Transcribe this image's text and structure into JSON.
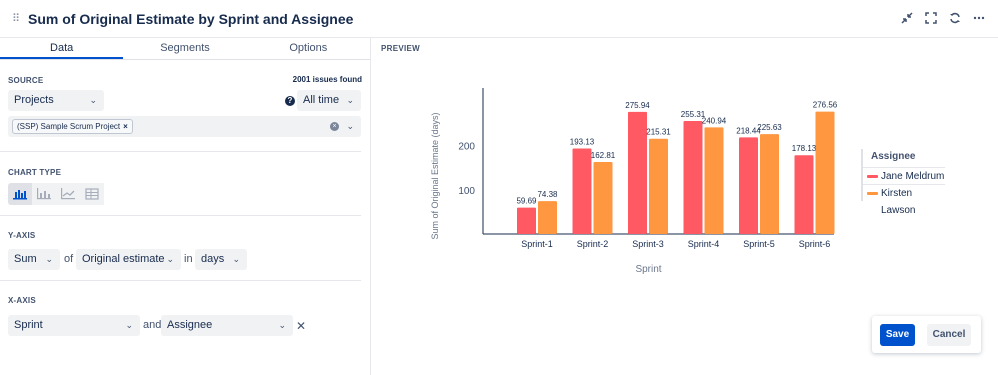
{
  "header": {
    "title": "Sum of Original Estimate by Sprint and Assignee",
    "drag_glyph": "⠿",
    "icons": [
      "minimize-icon",
      "fullscreen-icon",
      "refresh-icon",
      "more-icon"
    ]
  },
  "tabs": [
    {
      "label": "Data",
      "active": true
    },
    {
      "label": "Segments",
      "active": false
    },
    {
      "label": "Options",
      "active": false
    }
  ],
  "source": {
    "label": "SOURCE",
    "issues_found": "2001 issues found",
    "type_value": "Projects",
    "time_value": "All time",
    "project_tag": "(SSP) Sample Scrum Project"
  },
  "chart_type": {
    "label": "CHART TYPE",
    "options": [
      "bar-chart-icon",
      "stacked-bar-icon",
      "line-chart-icon",
      "table-icon"
    ],
    "selected": "bar-chart-icon"
  },
  "y_axis": {
    "label": "Y-AXIS",
    "aggregation": "Sum",
    "word_of": "of",
    "field": "Original estimate",
    "word_in": "in",
    "unit": "days"
  },
  "x_axis": {
    "label": "X-AXIS",
    "field": "Sprint",
    "word_and": "and",
    "segment": "Assignee"
  },
  "preview": {
    "label": "PREVIEW",
    "legend_title": "Assignee"
  },
  "chart_data": {
    "type": "bar",
    "xlabel": "Sprint",
    "ylabel": "Sum of Original Estimate (days)",
    "categories": [
      "Sprint-1",
      "Sprint-2",
      "Sprint-3",
      "Sprint-4",
      "Sprint-5",
      "Sprint-6"
    ],
    "series": [
      {
        "name": "Jane Meldrum",
        "color": "#ff5a64",
        "values": [
          59.69,
          193.13,
          275.94,
          255.31,
          218.44,
          178.13
        ],
        "labels": [
          "59.69",
          "193.13",
          "275.94",
          "255.31",
          "218.44",
          "178.13"
        ]
      },
      {
        "name": "Kirsten Lawson",
        "color": "#ff9640",
        "values": [
          74.38,
          162.81,
          215.31,
          240.94,
          225.63,
          276.56
        ],
        "labels": [
          "74.38",
          "162.81",
          "215.31",
          "240.94",
          "225.63",
          "276.56"
        ]
      }
    ],
    "yticks": [
      100,
      200
    ],
    "ylim": [
      0,
      330
    ],
    "legend_position": "right"
  },
  "actions": {
    "save_label": "Save",
    "cancel_label": "Cancel"
  }
}
